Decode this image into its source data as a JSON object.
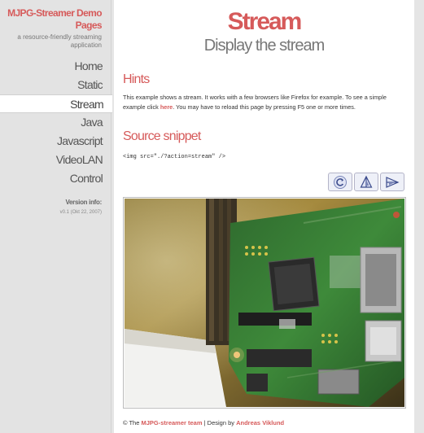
{
  "sidebar": {
    "brand_title": "MJPG-Streamer Demo Pages",
    "brand_subtitle": "a resource-friendly streaming application",
    "nav": [
      {
        "label": "Home",
        "active": false
      },
      {
        "label": "Static",
        "active": false
      },
      {
        "label": "Stream",
        "active": true
      },
      {
        "label": "Java",
        "active": false
      },
      {
        "label": "Javascript",
        "active": false
      },
      {
        "label": "VideoLAN",
        "active": false
      },
      {
        "label": "Control",
        "active": false
      }
    ],
    "version_label": "Version info:",
    "version_value": "v0.1 (Okt 22, 2007)"
  },
  "main": {
    "title": "Stream",
    "subtitle": "Display the stream",
    "hints_heading": "Hints",
    "hint_text_1": "This example shows a stream. It works with a few browsers like Firefox for example. To see a simple example click ",
    "hint_link": "here",
    "hint_text_2": ". You may have to reload this page by pressing F5 one or more times.",
    "source_heading": "Source snippet",
    "code_snippet": "<img src=\"./?action=stream\" />",
    "toolbar": [
      {
        "name": "rotate-icon"
      },
      {
        "name": "flip-icon"
      },
      {
        "name": "mirror-icon"
      }
    ],
    "stream_image": "live camera stream of a Raspberry Pi board",
    "footer": {
      "prefix": "© The ",
      "team_link": "MJPG-streamer team",
      "mid": " | Design by ",
      "designer_link": "Andreas Viklund"
    }
  }
}
